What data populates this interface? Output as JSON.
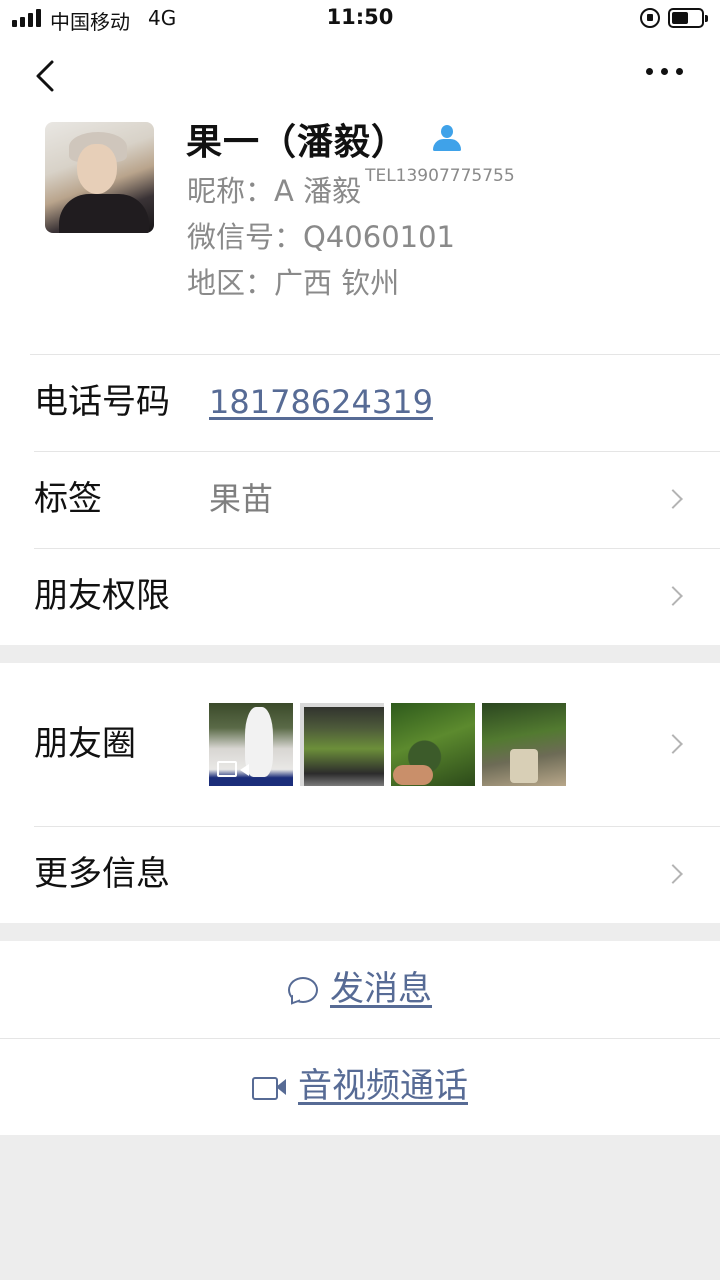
{
  "status_bar": {
    "carrier": "中国移动",
    "network": "4G",
    "time": "11:50"
  },
  "profile": {
    "display_name": "果一（潘毅）",
    "nickname_label": "昵称：",
    "nickname": "A 潘毅",
    "nickname_tel": "TEL13907775755",
    "wechat_id_label": "微信号：",
    "wechat_id": "Q4060101",
    "region_label": "地区：",
    "region": "广西 钦州"
  },
  "details": {
    "phone_label": "电话号码",
    "phone_value": "18178624319",
    "tag_label": "标签",
    "tag_value": "果苗",
    "permissions_label": "朋友权限"
  },
  "moments": {
    "label": "朋友圈"
  },
  "more_info": {
    "label": "更多信息"
  },
  "actions": {
    "message_label": "发消息",
    "call_label": "音视频通话"
  },
  "colors": {
    "link": "#576b95",
    "contact_icon": "#3fa2e9",
    "background": "#ededed"
  }
}
